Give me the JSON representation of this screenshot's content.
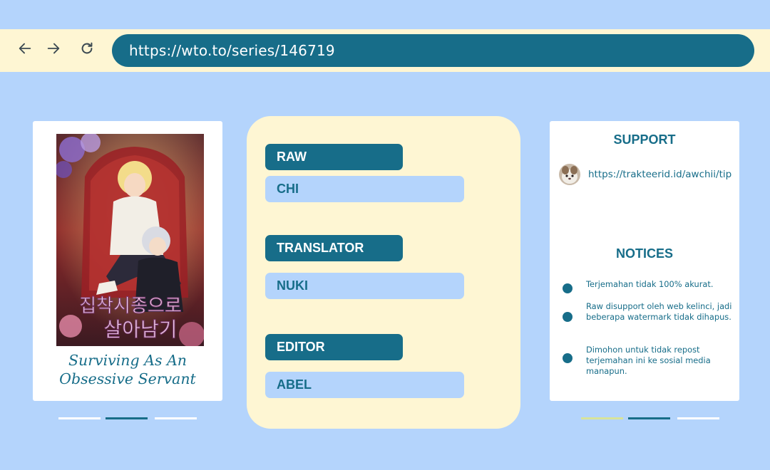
{
  "browser": {
    "url": "https://wto.to/series/146719",
    "back_icon": "arrow-left-icon",
    "forward_icon": "arrow-right-icon",
    "reload_icon": "reload-icon"
  },
  "cover": {
    "title_line1": "Surviving As An",
    "title_line2": "Obsessive Servant",
    "cover_text": "집착시종으로 살아남기"
  },
  "credits": {
    "raw_label": "RAW",
    "raw_value": "CHI",
    "translator_label": "TRANSLATOR",
    "translator_value": "NUKI",
    "editor_label": "EDITOR",
    "editor_value": "ABEL"
  },
  "support": {
    "title": "SUPPORT",
    "link": "https://trakteerid.id/awchii/tip"
  },
  "notices": {
    "title": "NOTICES",
    "items": [
      "Terjemahan tidak 100% akurat.",
      "Raw disupport oleh web kelinci, jadi beberapa watermark tidak dihapus.",
      "Dimohon untuk tidak repost terjemahan ini ke sosial media manapun."
    ]
  },
  "colors": {
    "background": "#b4d4fc",
    "accent": "#176d89",
    "cream": "#fef6d3",
    "pager_yellow": "#d8e49a"
  },
  "pagers": {
    "left_active_index": 1,
    "right_active_index": 1
  }
}
